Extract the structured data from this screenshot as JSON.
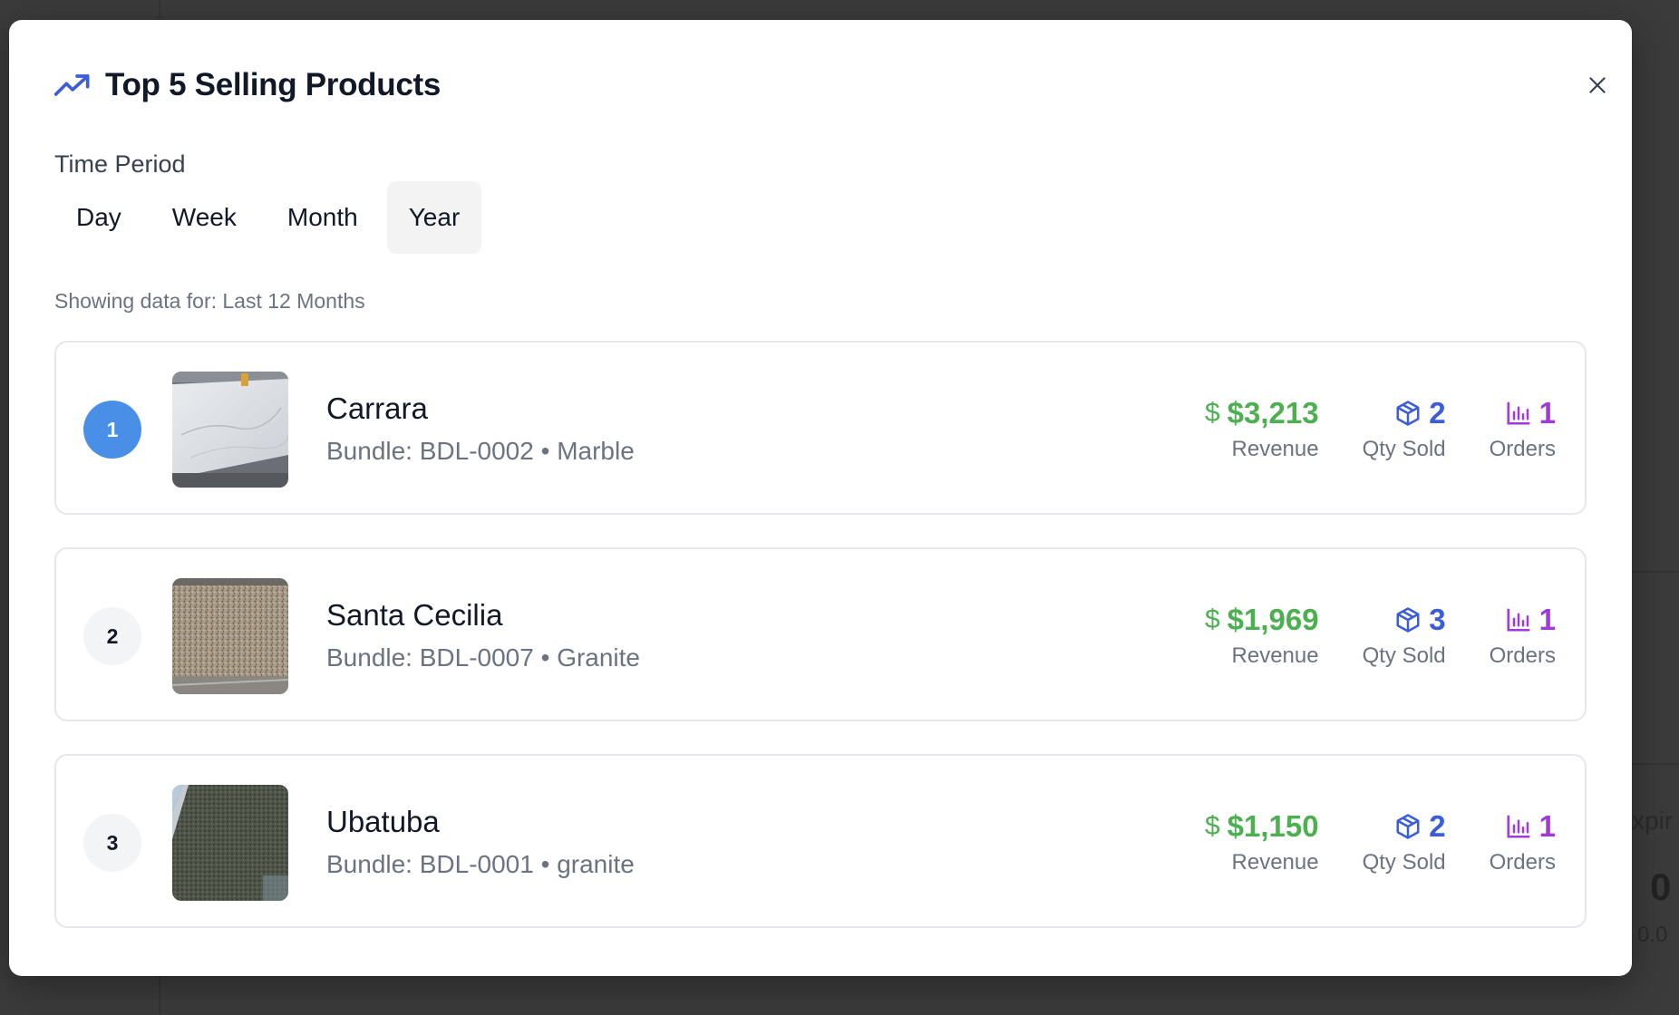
{
  "modal": {
    "title": "Top 5 Selling Products",
    "period_label": "Time Period",
    "tabs": [
      {
        "label": "Day",
        "active": false
      },
      {
        "label": "Week",
        "active": false
      },
      {
        "label": "Month",
        "active": false
      },
      {
        "label": "Year",
        "active": true
      }
    ],
    "showing_text": "Showing data for: Last 12 Months",
    "icons": {
      "title": "trending-up-icon",
      "close": "close-icon"
    }
  },
  "products": [
    {
      "rank": "1",
      "name": "Carrara",
      "subtitle": "Bundle: BDL-0002 • Marble",
      "revenue": "$3,213",
      "qty": "2",
      "orders": "1",
      "revenue_label": "Revenue",
      "qty_label": "Qty Sold",
      "orders_label": "Orders"
    },
    {
      "rank": "2",
      "name": "Santa Cecilia",
      "subtitle": "Bundle: BDL-0007 • Granite",
      "revenue": "$1,969",
      "qty": "3",
      "orders": "1",
      "revenue_label": "Revenue",
      "qty_label": "Qty Sold",
      "orders_label": "Orders"
    },
    {
      "rank": "3",
      "name": "Ubatuba",
      "subtitle": "Bundle: BDL-0001 • granite",
      "revenue": "$1,150",
      "qty": "2",
      "orders": "1",
      "revenue_label": "Revenue",
      "qty_label": "Qty Sold",
      "orders_label": "Orders"
    }
  ],
  "background": {
    "peek_text_1": "xpir",
    "peek_text_2": "0",
    "peek_text_3": "0.0"
  },
  "colors": {
    "revenue": "#4caf50",
    "qty": "#3b5ddb",
    "orders": "#a238e0",
    "rank_first": "#4a8fe7"
  }
}
